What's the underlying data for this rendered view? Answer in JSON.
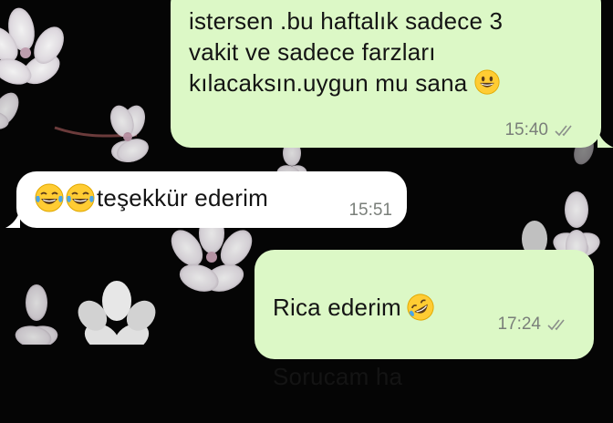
{
  "messages": [
    {
      "direction": "outgoing",
      "text": "istersen .bu haftalık sadece 3\nvakit ve sadece farzları\nkılacaksın.uygun mu sana",
      "emoji_after": "grinning-face",
      "time": "15:40",
      "status": "read"
    },
    {
      "direction": "incoming",
      "emoji_before": [
        "face-with-tears-of-joy",
        "face-with-tears-of-joy"
      ],
      "text": "teşekkür ederim",
      "time": "15:51"
    },
    {
      "direction": "outgoing",
      "line1": "Rica ederim",
      "emoji_after_line1": "rolling-on-floor-laughing",
      "line2": "Sorucam ha",
      "time": "17:24",
      "status": "read"
    }
  ],
  "colors": {
    "outgoing_bubble": "#dcf8c6",
    "incoming_bubble": "#ffffff",
    "wallpaper": "#050505",
    "meta_text": "#7a7f7a"
  }
}
